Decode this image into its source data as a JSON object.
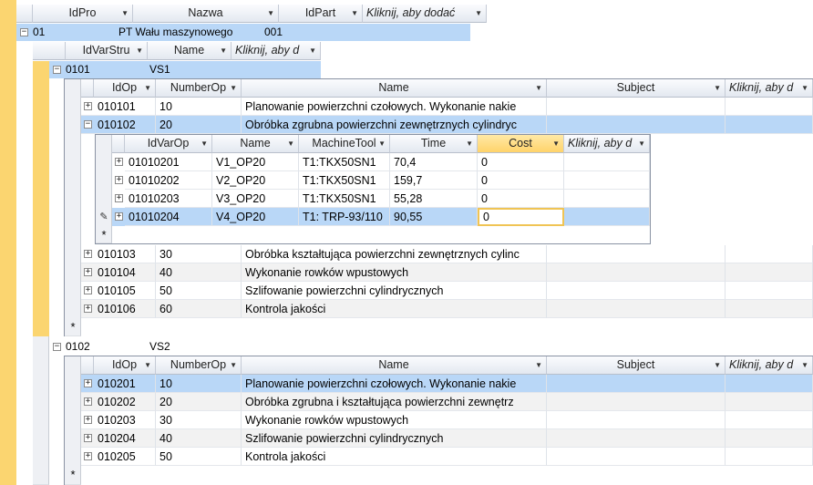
{
  "columns_top": [
    "IdPro",
    "Nazwa",
    "IdPart",
    "Kliknij, aby dodać"
  ],
  "top_row": {
    "idpro": "01",
    "nazwa": "PT Wału maszynowego",
    "idpart": "001"
  },
  "columns_var": [
    "IdVarStru",
    "Name",
    "Kliknij, aby d"
  ],
  "var1": {
    "id": "0101",
    "name": "VS1"
  },
  "var2": {
    "id": "0102",
    "name": "VS2"
  },
  "columns_op": [
    "IdOp",
    "NumberOp",
    "Name",
    "Subject",
    "Kliknij, aby d"
  ],
  "ops1": [
    {
      "id": "010101",
      "num": "10",
      "name": "Planowanie powierzchni czołowych. Wykonanie nakie"
    },
    {
      "id": "010102",
      "num": "20",
      "name": "Obróbka zgrubna powierzchni zewnętrznych cylindryc"
    },
    {
      "id": "010103",
      "num": "30",
      "name": "Obróbka kształtująca powierzchni zewnętrznych cylinc"
    },
    {
      "id": "010104",
      "num": "40",
      "name": "Wykonanie rowków wpustowych"
    },
    {
      "id": "010105",
      "num": "50",
      "name": "Szlifowanie powierzchni cylindrycznych"
    },
    {
      "id": "010106",
      "num": "60",
      "name": "Kontrola jakości"
    }
  ],
  "columns_varop": [
    "IdVarOp",
    "Name",
    "MachineTool",
    "Time",
    "Cost",
    "Kliknij, aby d"
  ],
  "varops": [
    {
      "id": "01010201",
      "name": "V1_OP20",
      "machine": "T1:TKX50SN1",
      "time": "70,4",
      "cost": "0"
    },
    {
      "id": "01010202",
      "name": "V2_OP20",
      "machine": "T1:TKX50SN1",
      "time": "159,7",
      "cost": "0"
    },
    {
      "id": "01010203",
      "name": "V3_OP20",
      "machine": "T1:TKX50SN1",
      "time": "55,28",
      "cost": "0"
    },
    {
      "id": "01010204",
      "name": "V4_OP20",
      "machine": "T1: TRP-93/110",
      "time": "90,55",
      "cost": "0"
    }
  ],
  "ops2": [
    {
      "id": "010201",
      "num": "10",
      "name": "Planowanie powierzchni czołowych. Wykonanie nakie"
    },
    {
      "id": "010202",
      "num": "20",
      "name": "Obróbka zgrubna i kształtująca  powierzchni zewnętrz"
    },
    {
      "id": "010203",
      "num": "30",
      "name": "Wykonanie rowków wpustowych"
    },
    {
      "id": "010204",
      "num": "40",
      "name": "Szlifowanie powierzchni cylindrycznych"
    },
    {
      "id": "010205",
      "num": "50",
      "name": "Kontrola jakości"
    }
  ],
  "new_row_symbol": "*",
  "expand_symbol": "⊟",
  "collapse_symbol": "⊞"
}
